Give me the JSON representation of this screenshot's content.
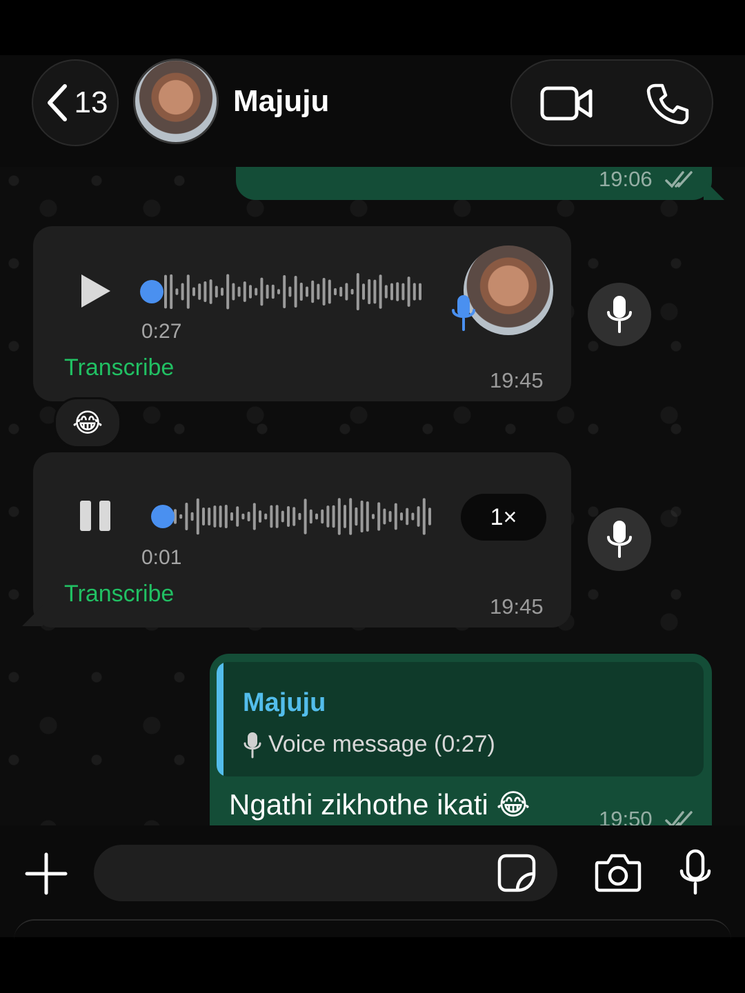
{
  "header": {
    "back_count": "13",
    "contact_name": "Majuju",
    "video_icon": "video-camera-icon",
    "call_icon": "phone-icon"
  },
  "messages": {
    "prev_out_time": "19:06",
    "voice1": {
      "duration": "0:27",
      "transcribe": "Transcribe",
      "time": "19:45",
      "reaction": "😂"
    },
    "voice2": {
      "duration": "0:01",
      "transcribe": "Transcribe",
      "time": "19:45",
      "speed": "1×"
    },
    "reply": {
      "quoted_name": "Majuju",
      "quoted_text": "Voice message (0:27)",
      "text": "Ngathi zikhothe ikati 😂",
      "time": "19:50"
    }
  },
  "composer": {
    "plus_icon": "plus-icon",
    "sticker_icon": "sticker-icon",
    "camera_icon": "camera-icon",
    "mic_icon": "microphone-icon"
  },
  "colors": {
    "accent_green": "#21c063",
    "outgoing_bubble": "#144d37",
    "incoming_bubble": "#1f1f1f",
    "voice_dot_blue": "#4a90f0",
    "quote_name_blue": "#53bdeb"
  }
}
